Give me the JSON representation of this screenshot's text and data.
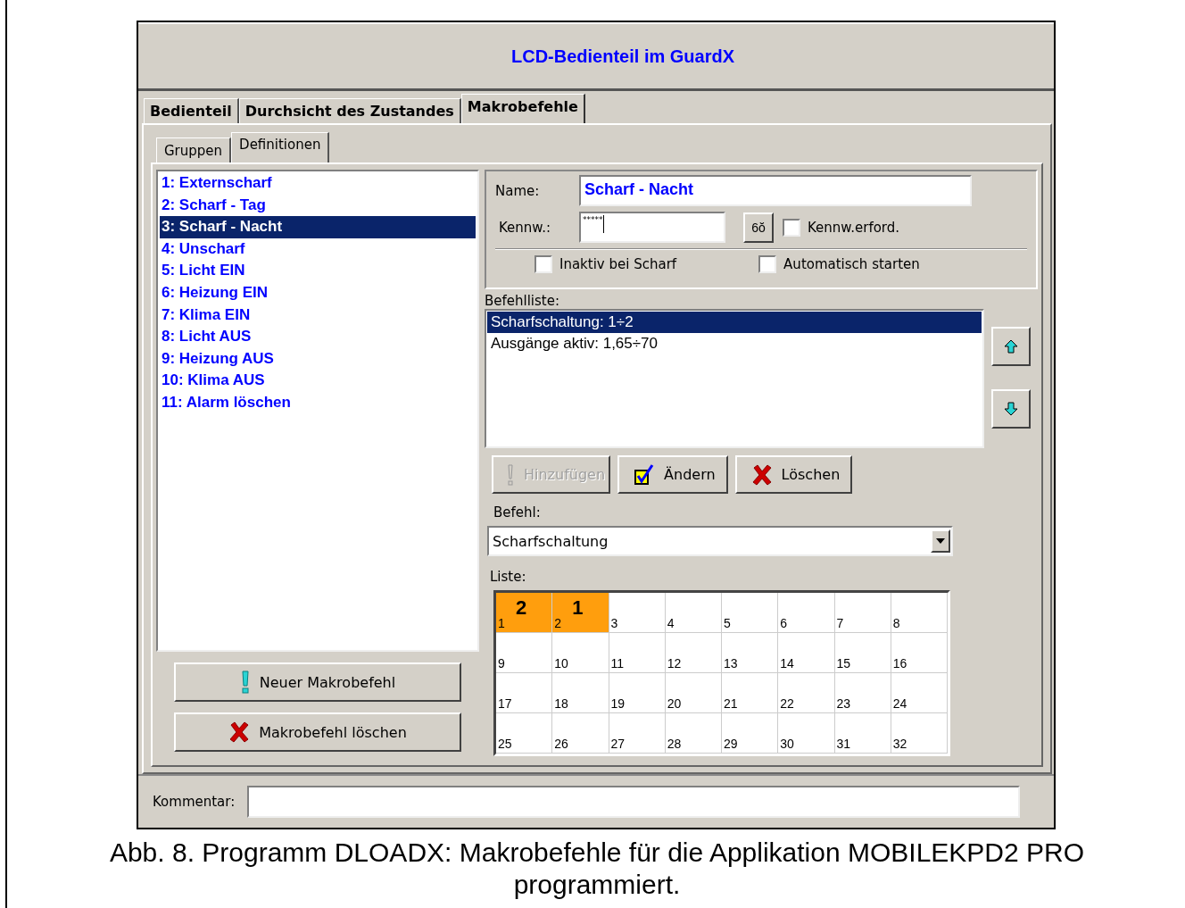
{
  "window": {
    "title": "LCD-Bedienteil im GuardX"
  },
  "tabs": [
    {
      "label": "Bedienteil",
      "selected": false
    },
    {
      "label": "Durchsicht des Zustandes",
      "selected": false
    },
    {
      "label": "Makrobefehle",
      "selected": true
    }
  ],
  "subtabs": [
    {
      "label": "Gruppen",
      "selected": false
    },
    {
      "label": "Definitionen",
      "selected": true
    }
  ],
  "macros": [
    {
      "label": "1: Externscharf",
      "selected": false
    },
    {
      "label": "2: Scharf - Tag",
      "selected": false
    },
    {
      "label": "3: Scharf - Nacht",
      "selected": true
    },
    {
      "label": "4: Unscharf",
      "selected": false
    },
    {
      "label": "5: Licht EIN",
      "selected": false
    },
    {
      "label": "6: Heizung EIN",
      "selected": false
    },
    {
      "label": "7: Klima EIN",
      "selected": false
    },
    {
      "label": "8: Licht AUS",
      "selected": false
    },
    {
      "label": "9: Heizung AUS",
      "selected": false
    },
    {
      "label": "10: Klima AUS",
      "selected": false
    },
    {
      "label": "11: Alarm löschen",
      "selected": false
    }
  ],
  "macro_buttons": [
    {
      "label": "Neuer Makrobefehl",
      "kind": "add"
    },
    {
      "label": "Makrobefehl löschen",
      "kind": "delete"
    }
  ],
  "form": {
    "name_label": "Name:",
    "name_value": "Scharf - Nacht",
    "password_label": "Kennw.:",
    "password_value": "*****",
    "reveal_button": "6ŏ",
    "checkboxes": [
      {
        "label": "Kennw.erford.",
        "checked": false
      },
      {
        "label": "Inaktiv bei Scharf",
        "checked": false
      },
      {
        "label": "Automatisch starten",
        "checked": false
      }
    ]
  },
  "command_list": {
    "label": "Befehlliste:",
    "items": [
      {
        "label": "Scharfschaltung: 1÷2",
        "selected": true
      },
      {
        "label": "Ausgänge aktiv: 1,65÷70",
        "selected": false
      }
    ]
  },
  "action_buttons": [
    {
      "label": "Hinzufügen",
      "kind": "add",
      "disabled": true
    },
    {
      "label": "Ändern",
      "kind": "edit",
      "disabled": false
    },
    {
      "label": "Löschen",
      "kind": "delete",
      "disabled": false
    }
  ],
  "command": {
    "label": "Befehl:",
    "value": "Scharfschaltung"
  },
  "grid": {
    "label": "Liste:",
    "cells": [
      {
        "number": "1",
        "order": "2",
        "selected": true
      },
      {
        "number": "2",
        "order": "1",
        "selected": true
      },
      {
        "number": "3",
        "selected": false
      },
      {
        "number": "4",
        "selected": false
      },
      {
        "number": "5",
        "selected": false
      },
      {
        "number": "6",
        "selected": false
      },
      {
        "number": "7",
        "selected": false
      },
      {
        "number": "8",
        "selected": false
      },
      {
        "number": "9",
        "selected": false
      },
      {
        "number": "10",
        "selected": false
      },
      {
        "number": "11",
        "selected": false
      },
      {
        "number": "12",
        "selected": false
      },
      {
        "number": "13",
        "selected": false
      },
      {
        "number": "14",
        "selected": false
      },
      {
        "number": "15",
        "selected": false
      },
      {
        "number": "16",
        "selected": false
      },
      {
        "number": "17",
        "selected": false
      },
      {
        "number": "18",
        "selected": false
      },
      {
        "number": "19",
        "selected": false
      },
      {
        "number": "20",
        "selected": false
      },
      {
        "number": "21",
        "selected": false
      },
      {
        "number": "22",
        "selected": false
      },
      {
        "number": "23",
        "selected": false
      },
      {
        "number": "24",
        "selected": false
      },
      {
        "number": "25",
        "selected": false
      },
      {
        "number": "26",
        "selected": false
      },
      {
        "number": "27",
        "selected": false
      },
      {
        "number": "28",
        "selected": false
      },
      {
        "number": "29",
        "selected": false
      },
      {
        "number": "30",
        "selected": false
      },
      {
        "number": "31",
        "selected": false
      },
      {
        "number": "32",
        "selected": false
      }
    ]
  },
  "comment": {
    "label": "Kommentar:"
  },
  "caption": "Abb. 8. Programm DLOADX: Makrobefehle für die Applikation MOBILEKPD2 PRO programmiert."
}
